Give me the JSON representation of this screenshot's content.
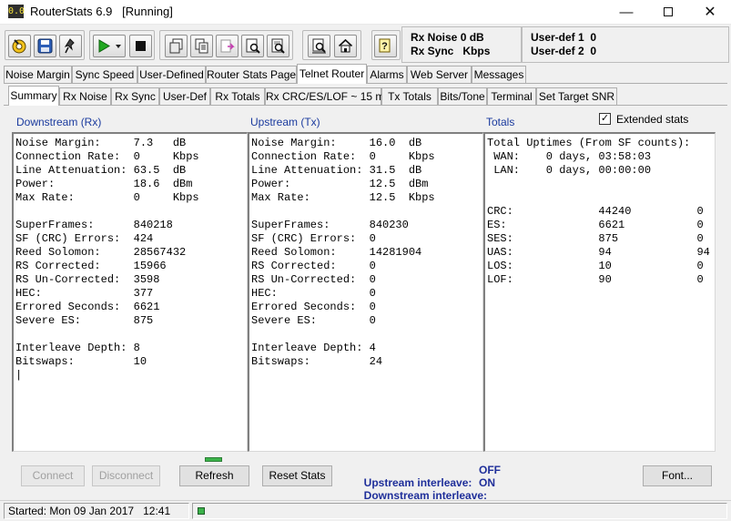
{
  "window": {
    "icon_text": "0.0",
    "title": "RouterStats 6.9",
    "state": "[Running]",
    "minimize_glyph": "—",
    "close_glyph": "✕"
  },
  "toolbar": {
    "icons": [
      "connect-wizard-icon",
      "save-icon",
      "pin-icon",
      "play-icon",
      "dropdown-arrow-icon",
      "stop-icon",
      "copy-icon",
      "copy-text-icon",
      "paste-icon",
      "preview-icon",
      "preview-zoom-icon",
      "report-icon",
      "home-icon",
      "help-icon"
    ],
    "status1": {
      "label1": "Rx Noise",
      "value1": "0 dB",
      "label2": "Rx Sync",
      "value2": "Kbps"
    },
    "status2": {
      "label1": "User-def 1",
      "value1": "0",
      "label2": "User-def 2",
      "value2": "0"
    }
  },
  "main_tabs": [
    "Noise Margin",
    "Sync Speed",
    "User-Defined",
    "Router Stats Page",
    "Telnet Router",
    "Alarms",
    "Web Server",
    "Messages"
  ],
  "main_tab_active": "Telnet Router",
  "sub_tabs": [
    "Summary",
    "Rx Noise",
    "Rx Sync",
    "User-Def",
    "Rx  Totals",
    "Rx CRC/ES/LOF ~ 15 min",
    "Tx  Totals",
    "Bits/Tone",
    "Terminal",
    "Set Target SNR"
  ],
  "sub_tab_active": "Summary",
  "sections": {
    "downstream_title": "Downstream (Rx)",
    "upstream_title": "Upstream (Tx)",
    "totals_title": "Totals",
    "extended_label": "Extended stats",
    "extended_checked": true
  },
  "downstream_text": "Noise Margin:     7.3   dB\nConnection Rate:  0     Kbps\nLine Attenuation: 63.5  dB\nPower:            18.6  dBm\nMax Rate:         0     Kbps\n\nSuperFrames:      840218\nSF (CRC) Errors:  424\nReed Solomon:     28567432\nRS Corrected:     15966\nRS Un-Corrected:  3598\nHEC:              377\nErrored Seconds:  6621\nSevere ES:        875\n\nInterleave Depth: 8\nBitswaps:         10\n|",
  "upstream_text": "Noise Margin:     16.0  dB\nConnection Rate:  0     Kbps\nLine Attenuation: 31.5  dB\nPower:            12.5  dBm\nMax Rate:         12.5  Kbps\n\nSuperFrames:      840230\nSF (CRC) Errors:  0\nReed Solomon:     14281904\nRS Corrected:     0\nRS Un-Corrected:  0\nHEC:              0\nErrored Seconds:  0\nSevere ES:        0\n\nInterleave Depth: 4\nBitswaps:         24",
  "totals_text": "Total Uptimes (From SF counts):\n WAN:    0 days, 03:58:03\n LAN:    0 days, 00:00:00\n\n\nCRC:             44240          0\nES:              6621           0\nSES:             875            0\nUAS:             94             94\nLOS:             10             0\nLOF:             90             0",
  "buttons": {
    "connect": "Connect",
    "disconnect": "Disconnect",
    "refresh": "Refresh",
    "reset": "Reset Stats",
    "font": "Font..."
  },
  "interleave": {
    "upstream_label": "Upstream interleave:",
    "upstream_value": "OFF",
    "downstream_label": "Downstream interleave:",
    "downstream_value": "ON"
  },
  "statusbar": {
    "started": "Started: Mon 09 Jan 2017   12:41"
  },
  "colors": {
    "accent_blue": "#1a3a9e",
    "led_green": "#3bb34a",
    "play_green": "#21a821"
  }
}
